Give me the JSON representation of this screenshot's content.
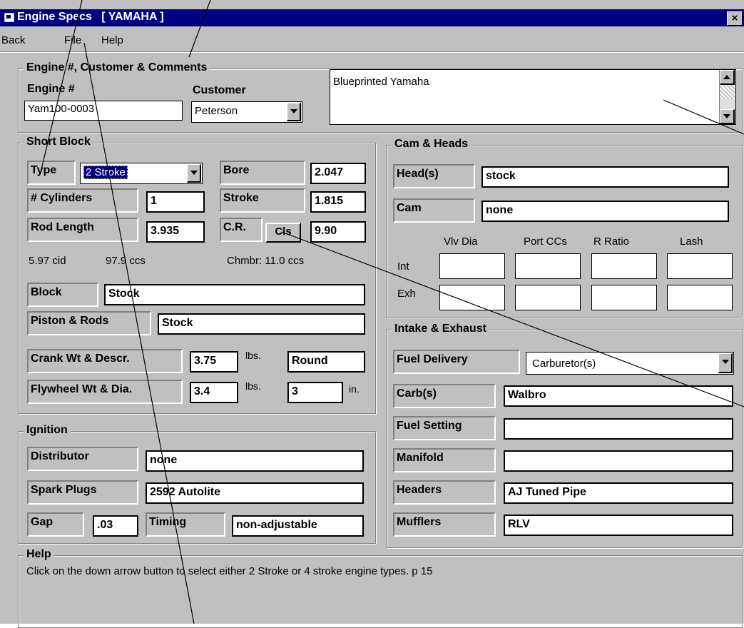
{
  "window": {
    "title": "Engine Specs   [ YAMAHA ]",
    "close": "×"
  },
  "menu": {
    "back": "Back",
    "file": "File",
    "help": "Help"
  },
  "engine_group": {
    "title": "Engine #, Customer & Comments",
    "engine_label": "Engine #",
    "engine_value": "Yam100-0003",
    "customer_label": "Customer",
    "customer_value": "Peterson",
    "comments": "Blueprinted Yamaha"
  },
  "short_block": {
    "title": "Short Block",
    "type_label": "Type",
    "type_value": "2 Stroke",
    "cylinders_label": "# Cylinders",
    "cylinders_value": "1",
    "rod_label": "Rod Length",
    "rod_value": "3.935",
    "bore_label": "Bore",
    "bore_value": "2.047",
    "stroke_label": "Stroke",
    "stroke_value": "1.815",
    "cr_label": "C.R.",
    "cls_button": "Cls",
    "cr_value": "9.90",
    "cid": "5.97 cid",
    "ccs": "97.9 ccs",
    "chamber": "Chmbr: 11.0 ccs",
    "block_label": "Block",
    "block_value": "Stock",
    "piston_label": "Piston & Rods",
    "piston_value": "Stock",
    "crank_label": "Crank Wt & Descr.",
    "crank_wt": "3.75",
    "crank_unit": "lbs.",
    "crank_descr": "Round",
    "flywheel_label": "Flywheel Wt & Dia.",
    "flywheel_wt": "3.4",
    "flywheel_unit": "lbs.",
    "flywheel_dia": "3",
    "flywheel_dia_unit": "in."
  },
  "ignition": {
    "title": "Ignition",
    "distributor_label": "Distributor",
    "distributor_value": "none",
    "plugs_label": "Spark Plugs",
    "plugs_value": "2592 Autolite",
    "gap_label": "Gap",
    "gap_value": ".03",
    "timing_label": "Timing",
    "timing_value": "non-adjustable"
  },
  "cam_heads": {
    "title": "Cam & Heads",
    "heads_label": "Head(s)",
    "heads_value": "stock",
    "cam_label": "Cam",
    "cam_value": "none",
    "col_vlv": "Vlv Dia",
    "col_port": "Port CCs",
    "col_ratio": "R Ratio",
    "col_lash": "Lash",
    "int_label": "Int",
    "exh_label": "Exh",
    "int_values": [
      "",
      "",
      "",
      ""
    ],
    "exh_values": [
      "",
      "",
      "",
      ""
    ]
  },
  "intake_exhaust": {
    "title": "Intake & Exhaust",
    "fuel_delivery_label": "Fuel Delivery",
    "fuel_delivery_value": "Carburetor(s)",
    "carb_label": "Carb(s)",
    "carb_value": "Walbro",
    "fuel_setting_label": "Fuel Setting",
    "fuel_setting_value": "",
    "manifold_label": "Manifold",
    "manifold_value": "",
    "headers_label": "Headers",
    "headers_value": "AJ Tuned Pipe",
    "mufflers_label": "Mufflers",
    "mufflers_value": "RLV"
  },
  "help": {
    "title": "Help",
    "text": "Click on the down arrow button to select either 2 Stroke or 4 stroke engine types.  p 15"
  }
}
